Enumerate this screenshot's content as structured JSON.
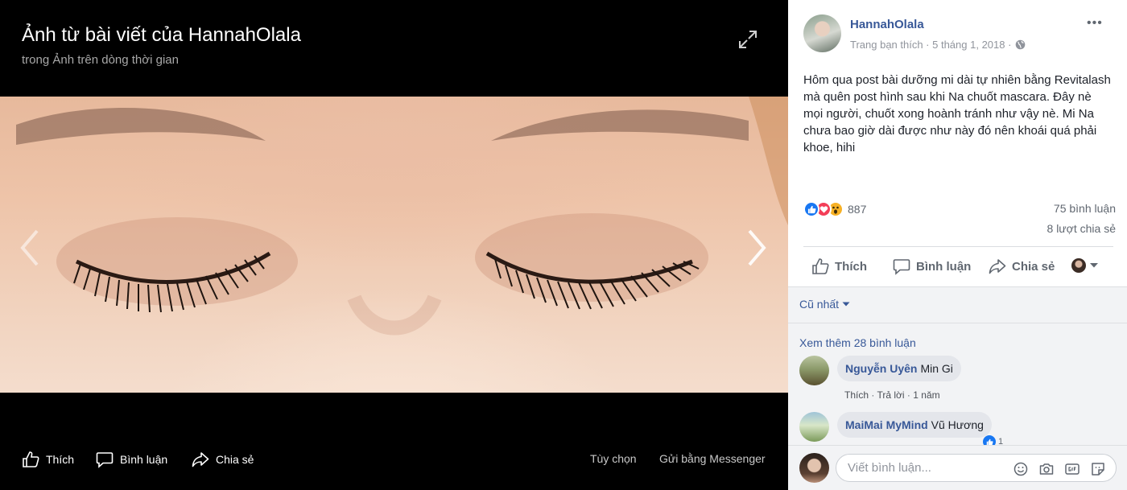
{
  "viewer": {
    "title": "Ảnh từ bài viết của HannahOlala",
    "subtitle": "trong Ảnh trên dòng thời gian",
    "actions": {
      "like": "Thích",
      "comment": "Bình luận",
      "share": "Chia sẻ",
      "options": "Tùy chọn",
      "send_messenger": "Gửi bằng Messenger"
    }
  },
  "post": {
    "author": "HannahOlala",
    "meta": "Trang bạn thích · 5 tháng 1, 2018 ·",
    "more": "•••",
    "text": "Hôm qua post bài dưỡng mi dài tự nhiên bằng Revitalash mà quên post hình sau khi Na chuốt mascara. Đây nè mọi người, chuốt xong hoành tránh như vậy nè. Mi Na chưa bao giờ dài được như này đó nên khoái quá phải khoe, hihi",
    "reaction_count": "887",
    "comment_count": "75 bình luận",
    "share_count": "8 lượt chia sẻ",
    "actions": {
      "like": "Thích",
      "comment": "Bình luận",
      "share": "Chia sẻ"
    }
  },
  "comments": {
    "sort_label": "Cũ nhất",
    "see_more": "Xem thêm 28 bình luận",
    "items": [
      {
        "author": "Nguyễn Uyên",
        "text": "Min Gi",
        "like": "Thích",
        "reply": "Trả lời",
        "time": "1 năm"
      },
      {
        "author": "MaiMai MyMind",
        "text": "Vũ Hương",
        "reaction_count": "1"
      }
    ],
    "separator": "·"
  },
  "composer": {
    "placeholder": "Viết bình luận..."
  },
  "colors": {
    "link_blue": "#385898",
    "like_blue": "#1877f2",
    "love_red": "#f33e58",
    "wow_yellow": "#f7b125"
  }
}
